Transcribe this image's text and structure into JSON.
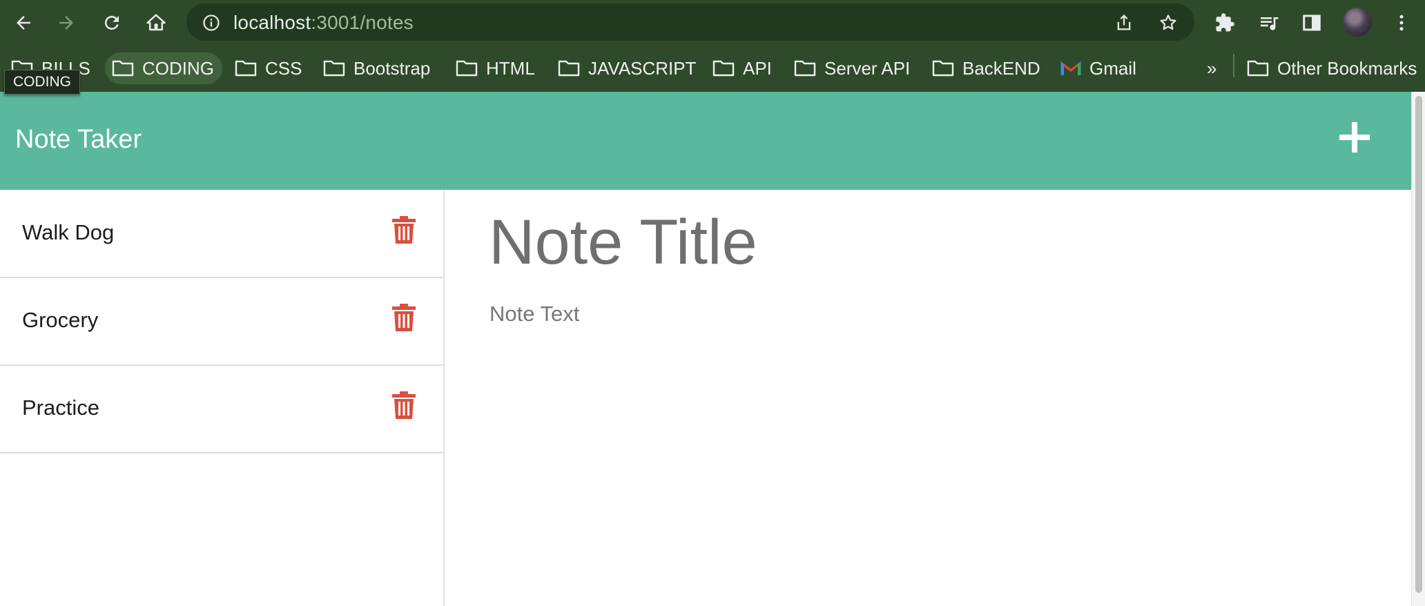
{
  "browser": {
    "url_host": "localhost",
    "url_rest": ":3001/notes",
    "bookmarks": [
      {
        "label": "BILLS",
        "icon": "folder-icon"
      },
      {
        "label": "CODING",
        "icon": "folder-icon"
      },
      {
        "label": "CSS",
        "icon": "folder-icon"
      },
      {
        "label": "Bootstrap",
        "icon": "folder-icon"
      },
      {
        "label": "HTML",
        "icon": "folder-icon"
      },
      {
        "label": "JAVASCRIPT",
        "icon": "folder-icon"
      },
      {
        "label": "API",
        "icon": "folder-icon"
      },
      {
        "label": "Server API",
        "icon": "folder-icon"
      },
      {
        "label": "BackEND",
        "icon": "folder-icon"
      },
      {
        "label": "Gmail",
        "icon": "gmail-icon"
      }
    ],
    "overflow_label": "»",
    "other_bookmarks": "Other Bookmarks",
    "tooltip": "CODING"
  },
  "app": {
    "title": "Note Taker",
    "accent_color": "#5ab99c",
    "delete_color": "#d9503f"
  },
  "notes": [
    {
      "title": "Walk Dog"
    },
    {
      "title": "Grocery"
    },
    {
      "title": "Practice"
    }
  ],
  "editor": {
    "title_placeholder": "Note Title",
    "text_placeholder": "Note Text"
  }
}
